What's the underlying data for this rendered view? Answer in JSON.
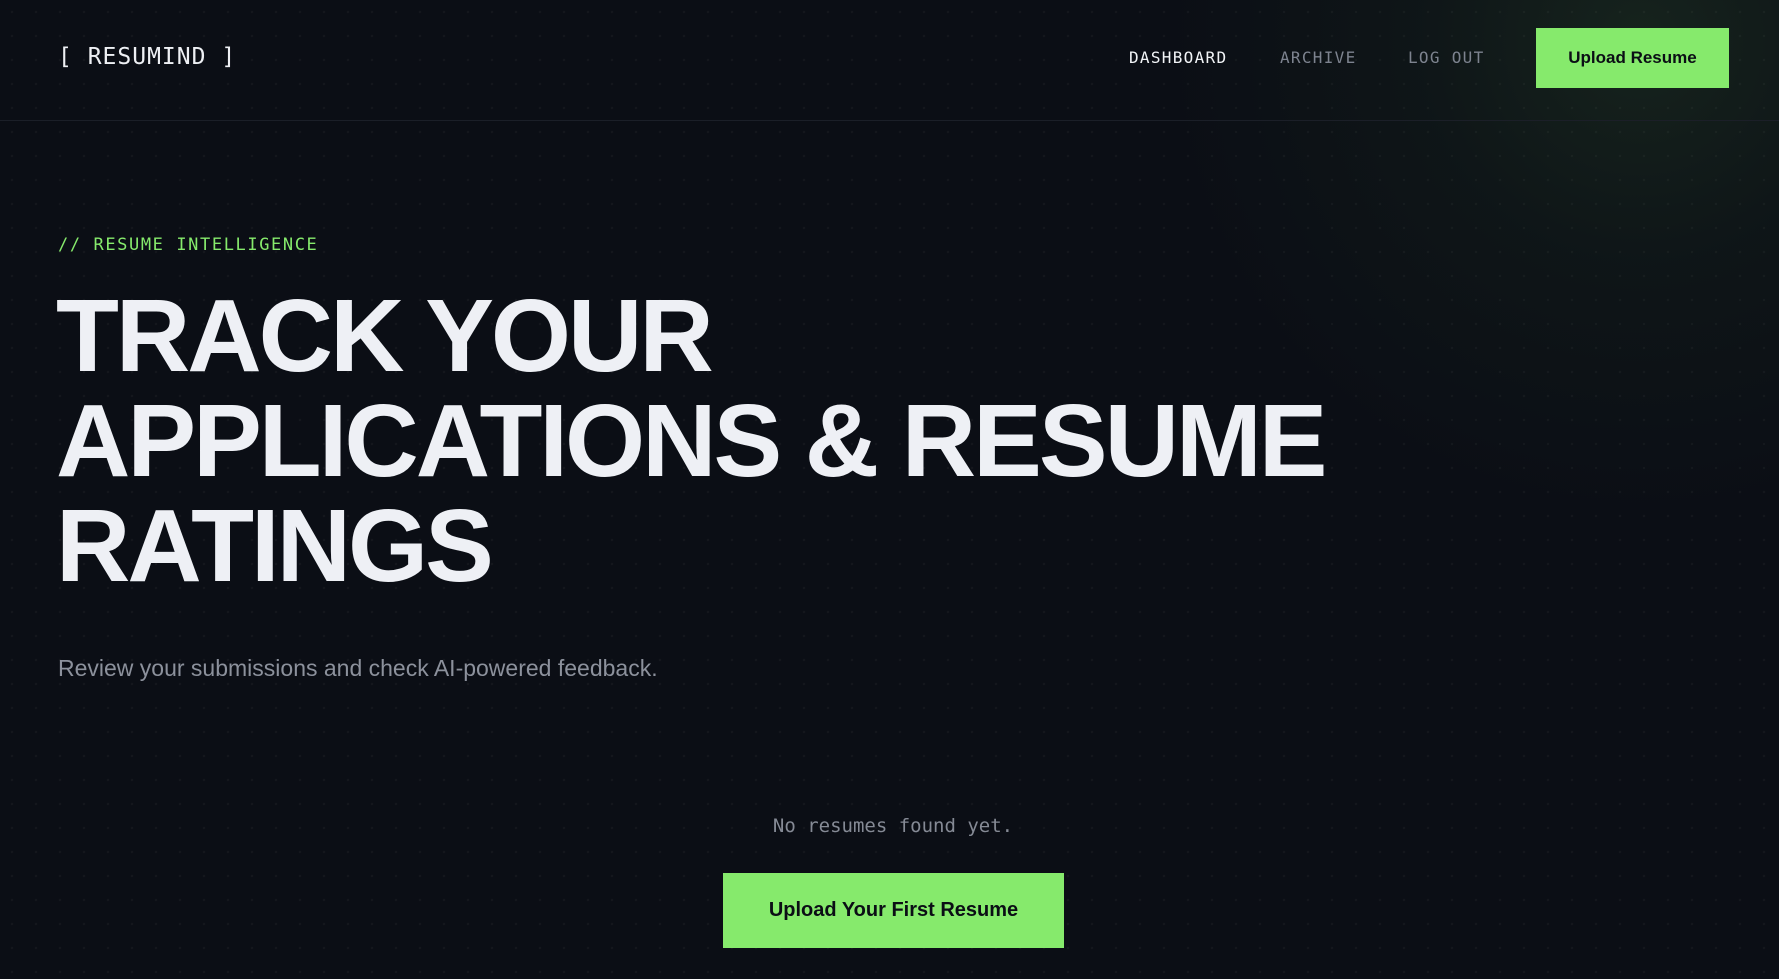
{
  "header": {
    "logo": "[ RESUMIND ]",
    "nav": {
      "dashboard": "DASHBOARD",
      "archive": "ARCHIVE",
      "logout": "LOG OUT"
    },
    "upload_button": "Upload Resume"
  },
  "hero": {
    "eyebrow": "// RESUME INTELLIGENCE",
    "title_lines": [
      "TRACK YOUR",
      "APPLICATIONS & RESUME",
      "RATINGS"
    ],
    "subtitle": "Review your submissions and check AI-powered feedback."
  },
  "empty_state": {
    "message": "No resumes found yet.",
    "cta": "Upload Your First Resume"
  },
  "colors": {
    "background": "#0b0e15",
    "accent": "#86ea6c",
    "text": "#eef0f4",
    "muted": "#7d838f"
  }
}
